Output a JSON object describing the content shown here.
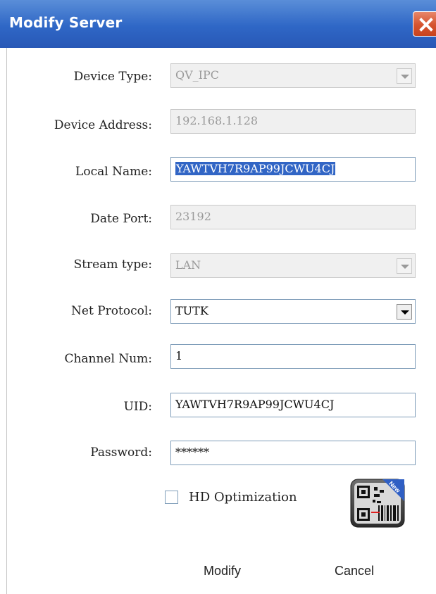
{
  "window": {
    "title": "Modify Server",
    "close_icon": "close-icon"
  },
  "form": {
    "device_type": {
      "label": "Device Type:",
      "value": "QV_IPC",
      "enabled": false
    },
    "device_address": {
      "label": "Device Address:",
      "value": "192.168.1.128",
      "enabled": false
    },
    "local_name": {
      "label": "Local Name:",
      "value": "YAWTVH7R9AP99JCWU4CJ",
      "selected": true
    },
    "date_port": {
      "label": "Date Port:",
      "value": "23192",
      "enabled": false
    },
    "stream_type": {
      "label": "Stream type:",
      "value": "LAN",
      "enabled": false
    },
    "net_protocol": {
      "label": "Net Protocol:",
      "value": "TUTK"
    },
    "channel_num": {
      "label": "Channel Num:",
      "value": "1"
    },
    "uid": {
      "label": "UID:",
      "value": "YAWTVH7R9AP99JCWU4CJ"
    },
    "password": {
      "label": "Password:",
      "value": "******"
    },
    "hd_optimization": {
      "label": "HD Optimization",
      "checked": false
    },
    "qr_badge": "New"
  },
  "buttons": {
    "modify": "Modify",
    "cancel": "Cancel"
  },
  "colors": {
    "title_bar": "#2f67c6",
    "close_button": "#d5532e",
    "selection": "#3165c5"
  }
}
